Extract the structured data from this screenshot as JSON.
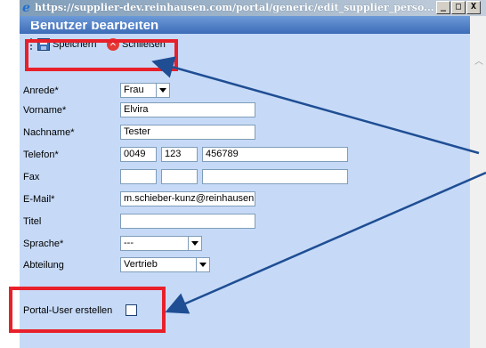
{
  "window": {
    "url": "https://supplier-dev.reinhausen.com/portal/generic/edit_supplier_perso...",
    "minimize_label": "_",
    "maximize_label": "□",
    "close_label": "X"
  },
  "header": {
    "title": "Benutzer bearbeiten"
  },
  "toolbar": {
    "save_label": "Speichern",
    "close_label": "Schließen"
  },
  "form": {
    "anrede": {
      "label": "Anrede*",
      "value": "Frau"
    },
    "vorname": {
      "label": "Vorname*",
      "value": "Elvira"
    },
    "nachname": {
      "label": "Nachname*",
      "value": "Tester"
    },
    "telefon": {
      "label": "Telefon*",
      "values": [
        "0049",
        "123",
        "456789"
      ]
    },
    "fax": {
      "label": "Fax",
      "values": [
        "",
        "",
        ""
      ]
    },
    "email": {
      "label": "E-Mail*",
      "value": "m.schieber-kunz@reinhausen."
    },
    "titel": {
      "label": "Titel",
      "value": ""
    },
    "sprache": {
      "label": "Sprache*",
      "value": "---"
    },
    "abteilung": {
      "label": "Abteilung",
      "value": "Vertrieb"
    },
    "portal_user": {
      "label": "Portal-User erstellen",
      "checked": false
    }
  },
  "colors": {
    "highlight": "#e8202a",
    "arrow": "#1f4e94",
    "panel_bg": "#c6daf7",
    "header_bg": "#3d6cb8"
  }
}
